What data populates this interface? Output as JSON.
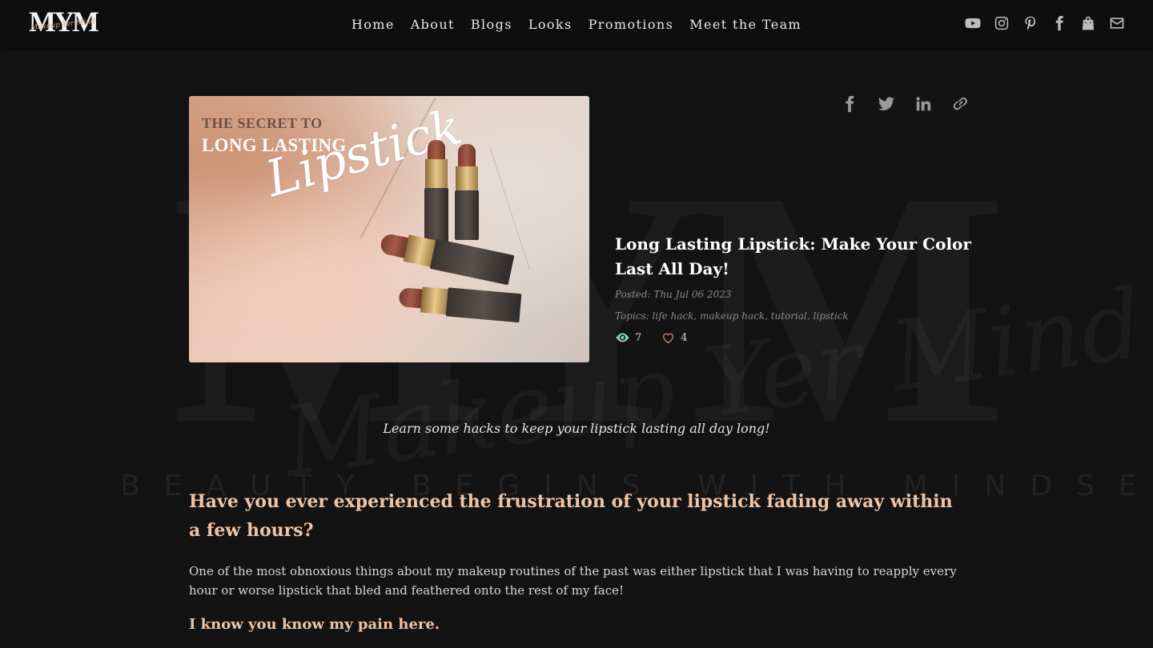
{
  "brand": {
    "logo_mark": "MYM",
    "logo_script": "Makeup Yer Mind",
    "watermark_letters": "MYM",
    "watermark_script": "Makeup Yer Mind",
    "watermark_tagline": "BEAUTY BEGINS WITH MINDSET"
  },
  "nav": {
    "items": [
      {
        "label": "Home"
      },
      {
        "label": "About"
      },
      {
        "label": "Blogs"
      },
      {
        "label": "Looks"
      },
      {
        "label": "Promotions"
      },
      {
        "label": "Meet the Team"
      }
    ]
  },
  "header_social": [
    "youtube-icon",
    "instagram-icon",
    "pinterest-icon",
    "facebook-icon",
    "shopping-bag-icon",
    "envelope-icon"
  ],
  "share": [
    "facebook-icon",
    "twitter-icon",
    "linkedin-icon",
    "link-icon"
  ],
  "hero": {
    "line1": "THE SECRET TO",
    "line2": "LONG LASTING",
    "line3": "Lipstick"
  },
  "post": {
    "title": "Long Lasting Lipstick: Make Your Color Last All Day!",
    "posted": "Posted: Thu Jul 06 2023",
    "topics": "Topics: life hack, makeup hack, tutorial, lipstick",
    "views": "7",
    "likes": "4"
  },
  "article": {
    "intro": "Learn some hacks to keep your lipstick lasting all day long!",
    "heading": "Have you ever experienced the frustration of your lipstick fading away within a few hours?",
    "paragraph": "One of the most obnoxious things about my makeup routines of the past was either lipstick that I was having to reapply every hour or worse lipstick that bled and feathered onto the rest of my face!",
    "subheading": "I know you know my pain here."
  },
  "colors": {
    "background": "#131313",
    "accent": "#f0c4a6",
    "nav_bg": "#0e0e0e",
    "eye_icon": "#7fd6b0",
    "heart_icon": "#d08a78"
  }
}
